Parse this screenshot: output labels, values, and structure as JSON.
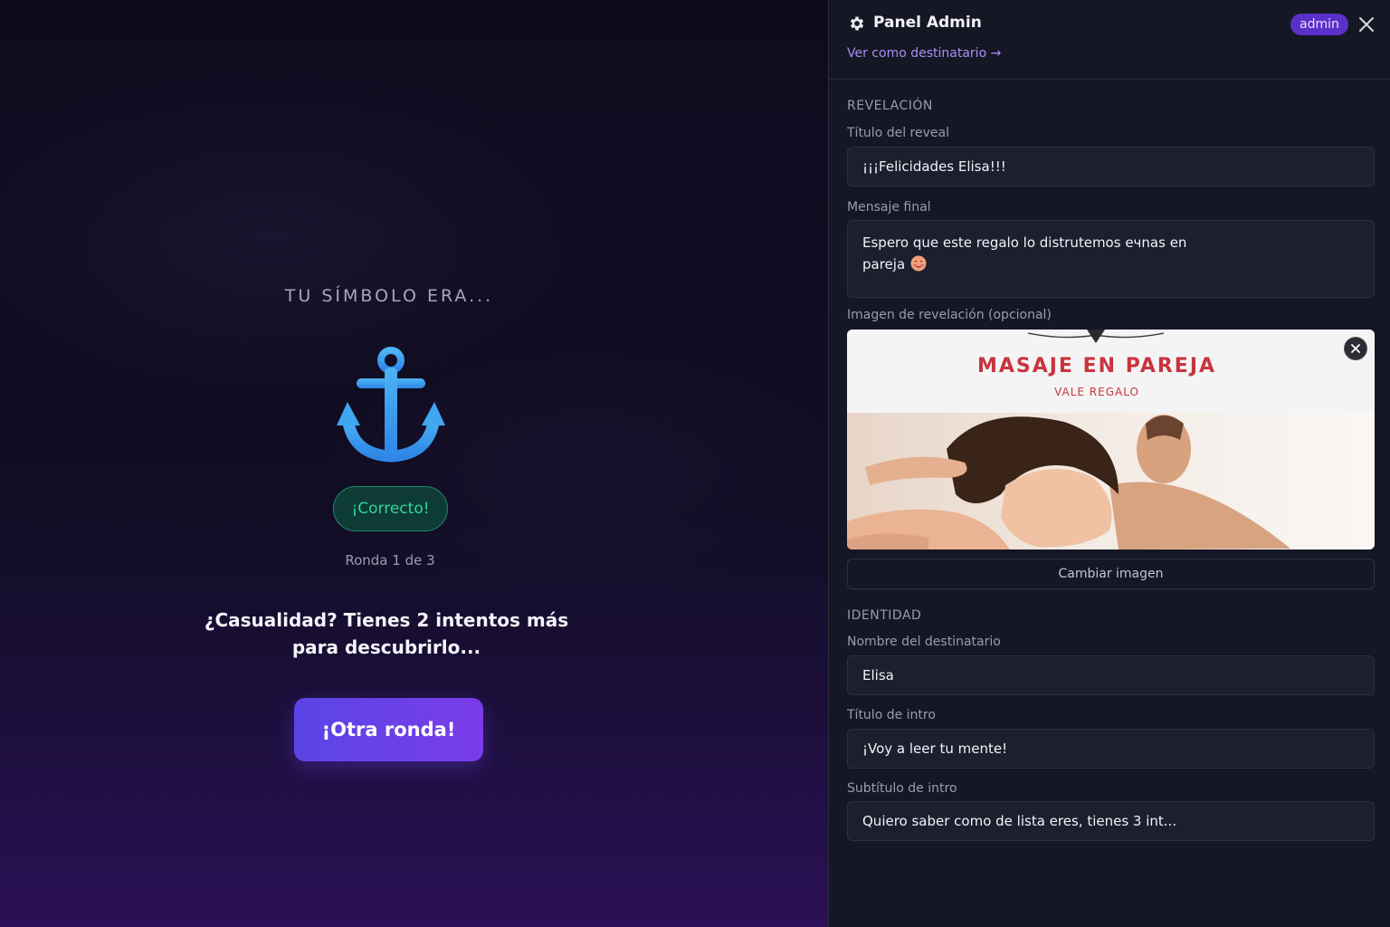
{
  "game": {
    "symbol_caption": "TU SÍMBOLO ERA...",
    "symbol_icon": "anchor-icon",
    "result_badge": "¡Correcto!",
    "round_label": "Ronda 1 de 3",
    "hint": "¿Casualidad? Tienes 2 intentos más para descubrirlo...",
    "again_button": "¡Otra ronda!"
  },
  "panel": {
    "title": "Panel Admin",
    "role_badge": "admin",
    "view_link": "Ver como destinatario →",
    "reveal": {
      "section": "REVELACIÓN",
      "title_label": "Título del reveal",
      "title_value": "¡¡¡Felicidades Elisa!!!",
      "message_label": "Mensaje final",
      "message_value": "Espero que este regalo lo distrutemos eчnas en pareja",
      "message_emoji": "blushing-face-icon",
      "image_label": "Imagen de revelación (opcional)",
      "image": {
        "title": "MASAJE EN PAREJA",
        "subtitle": "VALE REGALO"
      },
      "change_image_button": "Cambiar imagen"
    },
    "identity": {
      "section": "IDENTIDAD",
      "name_label": "Nombre del destinatario",
      "name_value": "Elisa",
      "intro_title_label": "Título de intro",
      "intro_title_value": "¡Voy a leer tu mente!",
      "intro_subtitle_label": "Subtítulo de intro",
      "intro_subtitle_value": "Quiero saber como de lista eres, tienes 3 int..."
    }
  },
  "colors": {
    "accent": "#6a42e8",
    "success": "#2fd69a",
    "link": "#a98ef5",
    "voucher_red": "#c9343f"
  }
}
